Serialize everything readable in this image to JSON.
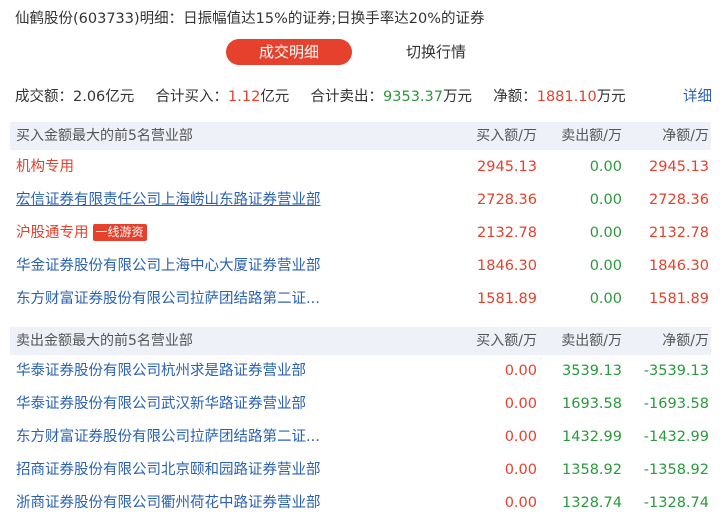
{
  "header": {
    "title": "仙鹤股份(603733)明细：日振幅值达15%的证券;日换手率达20%的证券"
  },
  "tabs": [
    {
      "label": "成交明细",
      "active": true
    },
    {
      "label": "切换行情",
      "active": false
    }
  ],
  "summary": {
    "turnover_label": "成交额：",
    "turnover_value": "2.06",
    "turnover_unit": "亿元",
    "buy_label": "合计买入：",
    "buy_value": "1.12",
    "buy_unit": "亿元",
    "sell_label": "合计卖出：",
    "sell_value": "9353.37",
    "sell_unit": "万元",
    "net_label": "净额：",
    "net_value": "1881.10",
    "net_unit": "万元",
    "detail_link": "详细"
  },
  "buy_section": {
    "heading": "买入金额最大的前5名营业部",
    "col_buy": "买入额/万",
    "col_sell": "卖出额/万",
    "col_net": "净额/万",
    "rows": [
      {
        "name": "机构专用",
        "badge": "",
        "buy": "2945.13",
        "sell": "0.00",
        "net": "2945.13"
      },
      {
        "name": "宏信证券有限责任公司上海崂山东路证券营业部",
        "badge": "",
        "buy": "2728.36",
        "sell": "0.00",
        "net": "2728.36"
      },
      {
        "name": "沪股通专用",
        "badge": "一线游资",
        "buy": "2132.78",
        "sell": "0.00",
        "net": "2132.78"
      },
      {
        "name": "华金证券股份有限公司上海中心大厦证券营业部",
        "badge": "",
        "buy": "1846.30",
        "sell": "0.00",
        "net": "1846.30"
      },
      {
        "name": "东方财富证券股份有限公司拉萨团结路第二证...",
        "badge": "",
        "buy": "1581.89",
        "sell": "0.00",
        "net": "1581.89"
      }
    ]
  },
  "sell_section": {
    "heading": "卖出金额最大的前5名营业部",
    "col_buy": "买入额/万",
    "col_sell": "卖出额/万",
    "col_net": "净额/万",
    "rows": [
      {
        "name": "华泰证券股份有限公司杭州求是路证券营业部",
        "buy": "0.00",
        "sell": "3539.13",
        "net": "-3539.13"
      },
      {
        "name": "华泰证券股份有限公司武汉新华路证券营业部",
        "buy": "0.00",
        "sell": "1693.58",
        "net": "-1693.58"
      },
      {
        "name": "东方财富证券股份有限公司拉萨团结路第二证...",
        "buy": "0.00",
        "sell": "1432.99",
        "net": "-1432.99"
      },
      {
        "name": "招商证券股份有限公司北京颐和园路证券营业部",
        "buy": "0.00",
        "sell": "1358.92",
        "net": "-1358.92"
      },
      {
        "name": "浙商证券股份有限公司衢州荷花中路证券营业部",
        "buy": "0.00",
        "sell": "1328.74",
        "net": "-1328.74"
      }
    ]
  },
  "colors": {
    "accent_red": "#e5412d",
    "green": "#2a9a3c",
    "link_blue": "#2a62b3",
    "section_bg": "#eef1f8"
  }
}
